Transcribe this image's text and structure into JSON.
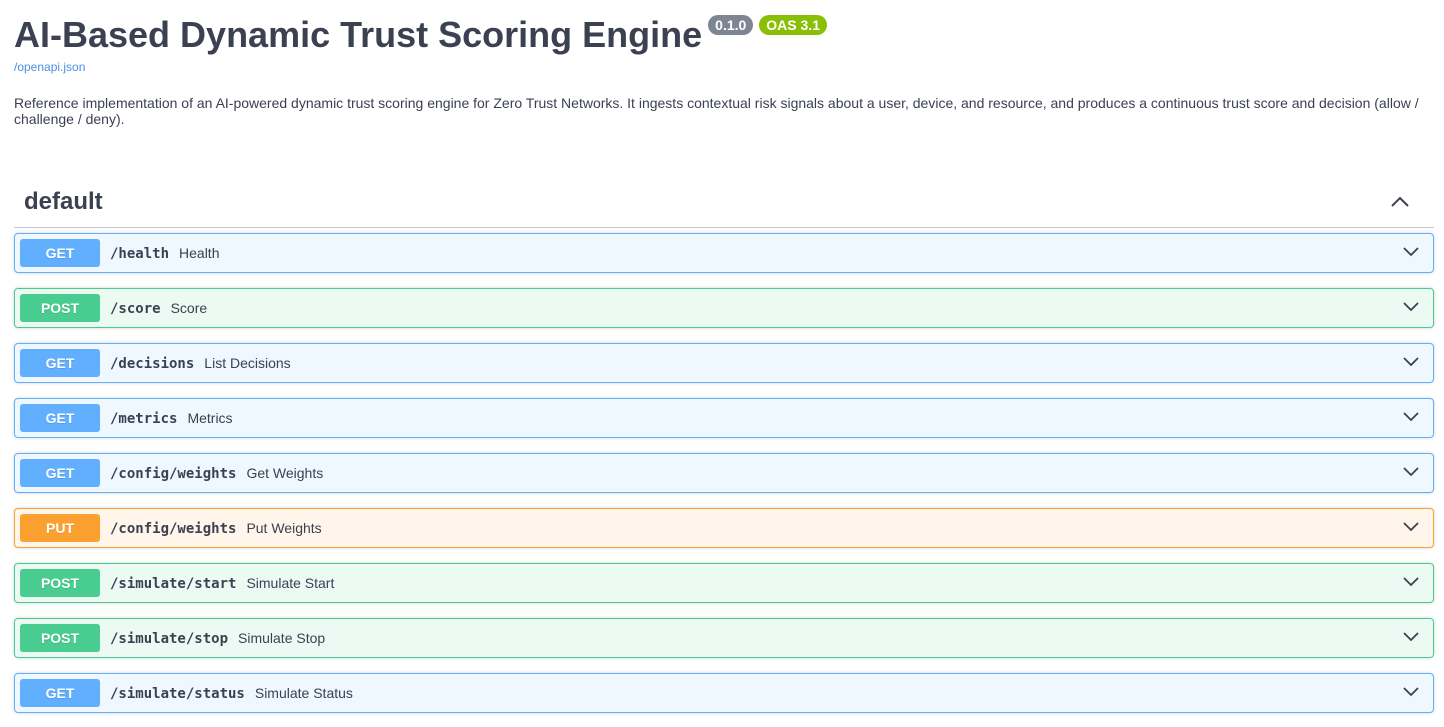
{
  "info": {
    "title": "AI-Based Dynamic Trust Scoring Engine",
    "version": "0.1.0",
    "oas": "OAS 3.1",
    "spec_link": "/openapi.json",
    "description": "Reference implementation of an AI-powered dynamic trust scoring engine for Zero Trust Networks. It ingests contextual risk signals about a user, device, and resource, and produces a continuous trust score and decision (allow / challenge / deny)."
  },
  "tag": {
    "name": "default",
    "toggle_icon": "chevron-up-icon"
  },
  "operations": [
    {
      "method": "GET",
      "path": "/health",
      "summary": "Health"
    },
    {
      "method": "POST",
      "path": "/score",
      "summary": "Score"
    },
    {
      "method": "GET",
      "path": "/decisions",
      "summary": "List Decisions"
    },
    {
      "method": "GET",
      "path": "/metrics",
      "summary": "Metrics"
    },
    {
      "method": "GET",
      "path": "/config/weights",
      "summary": "Get Weights"
    },
    {
      "method": "PUT",
      "path": "/config/weights",
      "summary": "Put Weights"
    },
    {
      "method": "POST",
      "path": "/simulate/start",
      "summary": "Simulate Start"
    },
    {
      "method": "POST",
      "path": "/simulate/stop",
      "summary": "Simulate Stop"
    },
    {
      "method": "GET",
      "path": "/simulate/status",
      "summary": "Simulate Status"
    }
  ],
  "colors": {
    "get": "#61affe",
    "post": "#49cc90",
    "put": "#fca130",
    "version_badge": "#7d8492",
    "oas_badge": "#89bf04",
    "link": "#4990e2"
  }
}
